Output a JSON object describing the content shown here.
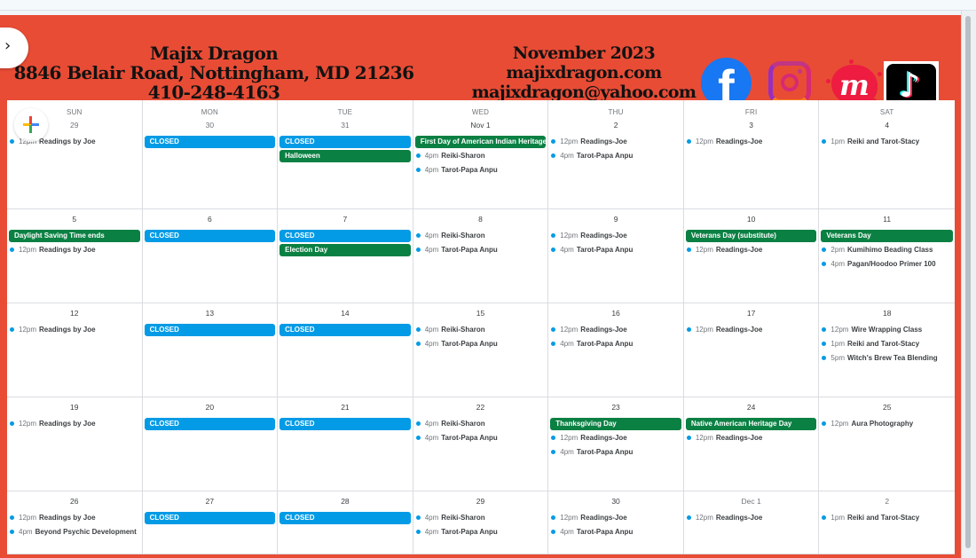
{
  "header": {
    "business_name": "Majix Dragon",
    "address": "8846 Belair Road, Nottingham, MD 21236",
    "phone": "410-248-4163",
    "month": "November 2023",
    "website": "majixdragon.com",
    "email": "majixdragon@yahoo.com",
    "social_icons": [
      "facebook-icon",
      "instagram-icon",
      "meetup-icon",
      "tiktok-icon"
    ],
    "facebook_glyph": "f",
    "meetup_glyph": "m",
    "tiktok_glyph": "♪"
  },
  "colors": {
    "banner": "#e84c35",
    "closed_chip": "#039be5",
    "holiday_chip": "#0b8043",
    "event_dot": "#039be5"
  },
  "controls": {
    "collapse_glyph": "›",
    "add_event": "create-event"
  },
  "weekdays": [
    "SUN",
    "MON",
    "TUE",
    "WED",
    "THU",
    "FRI",
    "SAT"
  ],
  "weeks": [
    [
      {
        "date": "29",
        "other": true,
        "chips": [],
        "events": [
          {
            "time": "12pm",
            "name": "Readings by Joe"
          }
        ]
      },
      {
        "date": "30",
        "other": true,
        "chips": [
          {
            "label": "CLOSED",
            "kind": "blue"
          }
        ],
        "events": []
      },
      {
        "date": "31",
        "other": true,
        "chips": [
          {
            "label": "CLOSED",
            "kind": "blue"
          },
          {
            "label": "Halloween",
            "kind": "green"
          }
        ],
        "events": []
      },
      {
        "date": "Nov 1",
        "chips": [
          {
            "label": "First Day of American Indian Heritage",
            "kind": "green"
          }
        ],
        "events": [
          {
            "time": "4pm",
            "name": "Reiki-Sharon"
          },
          {
            "time": "4pm",
            "name": "Tarot-Papa Anpu"
          }
        ]
      },
      {
        "date": "2",
        "chips": [],
        "events": [
          {
            "time": "12pm",
            "name": "Readings-Joe"
          },
          {
            "time": "4pm",
            "name": "Tarot-Papa Anpu"
          }
        ]
      },
      {
        "date": "3",
        "chips": [],
        "events": [
          {
            "time": "12pm",
            "name": "Readings-Joe"
          }
        ]
      },
      {
        "date": "4",
        "chips": [],
        "events": [
          {
            "time": "1pm",
            "name": "Reiki and Tarot-Stacy"
          }
        ]
      }
    ],
    [
      {
        "date": "5",
        "chips": [
          {
            "label": "Daylight Saving Time ends",
            "kind": "green"
          }
        ],
        "events": [
          {
            "time": "12pm",
            "name": "Readings by Joe"
          }
        ]
      },
      {
        "date": "6",
        "chips": [
          {
            "label": "CLOSED",
            "kind": "blue"
          }
        ],
        "events": []
      },
      {
        "date": "7",
        "chips": [
          {
            "label": "CLOSED",
            "kind": "blue"
          },
          {
            "label": "Election Day",
            "kind": "green"
          }
        ],
        "events": []
      },
      {
        "date": "8",
        "chips": [],
        "events": [
          {
            "time": "4pm",
            "name": "Reiki-Sharon"
          },
          {
            "time": "4pm",
            "name": "Tarot-Papa Anpu"
          }
        ]
      },
      {
        "date": "9",
        "chips": [],
        "events": [
          {
            "time": "12pm",
            "name": "Readings-Joe"
          },
          {
            "time": "4pm",
            "name": "Tarot-Papa Anpu"
          }
        ]
      },
      {
        "date": "10",
        "chips": [
          {
            "label": "Veterans Day (substitute)",
            "kind": "green"
          }
        ],
        "events": [
          {
            "time": "12pm",
            "name": "Readings-Joe"
          }
        ]
      },
      {
        "date": "11",
        "chips": [
          {
            "label": "Veterans Day",
            "kind": "green"
          }
        ],
        "events": [
          {
            "time": "2pm",
            "name": "Kumihimo Beading Class"
          },
          {
            "time": "4pm",
            "name": "Pagan/Hoodoo Primer 100"
          }
        ]
      }
    ],
    [
      {
        "date": "12",
        "chips": [],
        "events": [
          {
            "time": "12pm",
            "name": "Readings by Joe"
          }
        ]
      },
      {
        "date": "13",
        "chips": [
          {
            "label": "CLOSED",
            "kind": "blue"
          }
        ],
        "events": []
      },
      {
        "date": "14",
        "chips": [
          {
            "label": "CLOSED",
            "kind": "blue"
          }
        ],
        "events": []
      },
      {
        "date": "15",
        "chips": [],
        "events": [
          {
            "time": "4pm",
            "name": "Reiki-Sharon"
          },
          {
            "time": "4pm",
            "name": "Tarot-Papa Anpu"
          }
        ]
      },
      {
        "date": "16",
        "chips": [],
        "events": [
          {
            "time": "12pm",
            "name": "Readings-Joe"
          },
          {
            "time": "4pm",
            "name": "Tarot-Papa Anpu"
          }
        ]
      },
      {
        "date": "17",
        "chips": [],
        "events": [
          {
            "time": "12pm",
            "name": "Readings-Joe"
          }
        ]
      },
      {
        "date": "18",
        "chips": [],
        "events": [
          {
            "time": "12pm",
            "name": "Wire Wrapping Class"
          },
          {
            "time": "1pm",
            "name": "Reiki and Tarot-Stacy"
          },
          {
            "time": "5pm",
            "name": "Witch's Brew Tea Blending"
          }
        ]
      }
    ],
    [
      {
        "date": "19",
        "chips": [],
        "events": [
          {
            "time": "12pm",
            "name": "Readings by Joe"
          }
        ]
      },
      {
        "date": "20",
        "chips": [
          {
            "label": "CLOSED",
            "kind": "blue"
          }
        ],
        "events": []
      },
      {
        "date": "21",
        "chips": [
          {
            "label": "CLOSED",
            "kind": "blue"
          }
        ],
        "events": []
      },
      {
        "date": "22",
        "chips": [],
        "events": [
          {
            "time": "4pm",
            "name": "Reiki-Sharon"
          },
          {
            "time": "4pm",
            "name": "Tarot-Papa Anpu"
          }
        ]
      },
      {
        "date": "23",
        "chips": [
          {
            "label": "Thanksgiving Day",
            "kind": "green"
          }
        ],
        "events": [
          {
            "time": "12pm",
            "name": "Readings-Joe"
          },
          {
            "time": "4pm",
            "name": "Tarot-Papa Anpu"
          }
        ]
      },
      {
        "date": "24",
        "chips": [
          {
            "label": "Native American Heritage Day",
            "kind": "green"
          }
        ],
        "events": [
          {
            "time": "12pm",
            "name": "Readings-Joe"
          }
        ]
      },
      {
        "date": "25",
        "chips": [],
        "events": [
          {
            "time": "12pm",
            "name": "Aura Photography"
          }
        ]
      }
    ],
    [
      {
        "date": "26",
        "chips": [],
        "events": [
          {
            "time": "12pm",
            "name": "Readings by Joe"
          },
          {
            "time": "4pm",
            "name": "Beyond Psychic Development"
          }
        ]
      },
      {
        "date": "27",
        "chips": [
          {
            "label": "CLOSED",
            "kind": "blue"
          }
        ],
        "events": []
      },
      {
        "date": "28",
        "chips": [
          {
            "label": "CLOSED",
            "kind": "blue"
          }
        ],
        "events": []
      },
      {
        "date": "29",
        "chips": [],
        "events": [
          {
            "time": "4pm",
            "name": "Reiki-Sharon"
          },
          {
            "time": "4pm",
            "name": "Tarot-Papa Anpu"
          }
        ]
      },
      {
        "date": "30",
        "chips": [],
        "events": [
          {
            "time": "12pm",
            "name": "Readings-Joe"
          },
          {
            "time": "4pm",
            "name": "Tarot-Papa Anpu"
          }
        ]
      },
      {
        "date": "Dec 1",
        "other": true,
        "chips": [],
        "events": [
          {
            "time": "12pm",
            "name": "Readings-Joe"
          }
        ]
      },
      {
        "date": "2",
        "other": true,
        "chips": [],
        "events": [
          {
            "time": "1pm",
            "name": "Reiki and Tarot-Stacy"
          }
        ]
      }
    ]
  ]
}
